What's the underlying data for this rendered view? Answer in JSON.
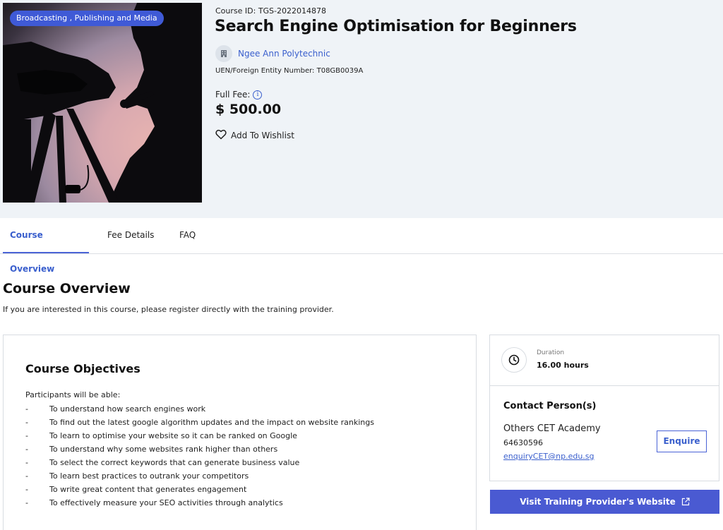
{
  "hero": {
    "category_badge": "Broadcasting , Publishing and Media",
    "course_id": "Course ID: TGS-2022014878",
    "title": "Search Engine Optimisation for Beginners",
    "provider": "Ngee Ann Polytechnic",
    "uen": "UEN/Foreign Entity Number: T08GB0039A",
    "fee_label": "Full Fee:",
    "fee_value": "$ 500.00",
    "wishlist_label": "Add To Wishlist",
    "icons": {
      "provider": "building-icon",
      "info": "info-icon",
      "wishlist": "heart-icon"
    }
  },
  "tabs": [
    {
      "label": "Course Overview",
      "active": true
    },
    {
      "label": "Fee Details",
      "active": false
    },
    {
      "label": "FAQ",
      "active": false
    }
  ],
  "overview": {
    "title": "Course Overview",
    "subtitle": "If you are interested in this course, please register directly with the training provider."
  },
  "objectives": {
    "title": "Course Objectives",
    "intro": "Participants will be able:",
    "bullet": "-",
    "items": [
      "To understand how search engines work",
      "To find out the latest google algorithm updates and the impact on website rankings",
      "To learn to optimise your website so it can be ranked on Google",
      "To understand why some websites rank higher than others",
      "To select the correct keywords that can generate business value",
      "To learn best practices to outrank your competitors",
      "To write great content that generates engagement",
      "To effectively measure your SEO activities through analytics"
    ]
  },
  "sidebar": {
    "duration_label": "Duration",
    "duration_value": "16.00 hours",
    "contact_title": "Contact Person(s)",
    "contact_name": "Others CET Academy",
    "contact_phone": "64630596",
    "contact_email": "enquiryCET@np.edu.sg",
    "enquire_label": "Enquire",
    "visit_label": "Visit Training Provider's Website",
    "icons": {
      "duration": "clock-icon",
      "visit": "external-link-icon"
    }
  },
  "colors": {
    "accent": "#3a5fcd",
    "button": "#4a5ad2",
    "hero_bg": "#eff3f7"
  }
}
